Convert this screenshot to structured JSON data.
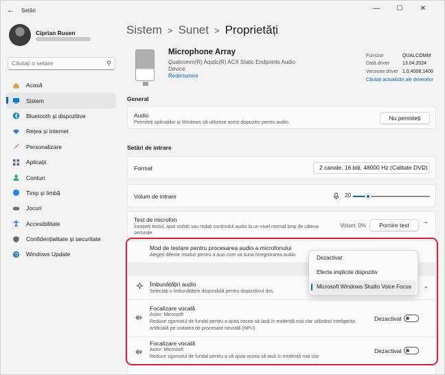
{
  "window": {
    "title": "Setări",
    "minimize_icon": "minimize-icon",
    "maximize_icon": "maximize-icon",
    "close_icon": "close-icon"
  },
  "user": {
    "name": "Ciprian Rusen"
  },
  "search": {
    "placeholder": "Căutați o setare"
  },
  "nav": [
    {
      "label": "Acasă",
      "icon": "home-icon",
      "color": "#d1a34a"
    },
    {
      "label": "Sistem",
      "icon": "system-icon",
      "color": "#0078d4"
    },
    {
      "label": "Bluetooth și dispozitive",
      "icon": "bluetooth-icon",
      "color": "#0078d4"
    },
    {
      "label": "Rețea și internet",
      "icon": "wifi-icon",
      "color": "#2b7cd3"
    },
    {
      "label": "Personalizare",
      "icon": "brush-icon",
      "color": "#e07a3a"
    },
    {
      "label": "Aplicații",
      "icon": "apps-icon",
      "color": "#5a6b86"
    },
    {
      "label": "Conturi",
      "icon": "account-icon",
      "color": "#2fa36b"
    },
    {
      "label": "Timp și limbă",
      "icon": "globe-icon",
      "color": "#1e88e5"
    },
    {
      "label": "Jocuri",
      "icon": "gamepad-icon",
      "color": "#707070"
    },
    {
      "label": "Accesibilitate",
      "icon": "accessibility-icon",
      "color": "#1a73c9"
    },
    {
      "label": "Confidențialitate și securitate",
      "icon": "shield-icon",
      "color": "#6b6b6b"
    },
    {
      "label": "Windows Update",
      "icon": "update-icon",
      "color": "#1a73c9"
    }
  ],
  "active_nav": "Sistem",
  "breadcrumb": [
    "Sistem",
    "Sunet",
    "Proprietăți"
  ],
  "device": {
    "name": "Microphone Array",
    "subtitle": "Qualcomm(R) Aqstic(R) ACX Static Endpoints Audio Device",
    "rename": "Redenumire",
    "info": [
      {
        "key": "Furnizor",
        "value": "QUALCOMM"
      },
      {
        "key": "Dată driver",
        "value": "13.04.2024"
      },
      {
        "key": "Versiune driver",
        "value": "1.0.4008.1400"
      }
    ],
    "driver_link": "Căutați actualizări ale driverelor"
  },
  "general": {
    "header": "General",
    "audio_title": "Audio",
    "audio_desc": "Permiteți aplicațiilor și Windows să utilizeze acest dispozitiv pentru audio",
    "audio_button": "Nu permiteți"
  },
  "input": {
    "header": "Setări de intrare",
    "format_label": "Format",
    "format_value": "2 canale, 16 biți, 48000 Hz (Calitate DVD)",
    "volume_label": "Volum de intrare",
    "volume_value": "20",
    "volume_level": 0.2
  },
  "mic_test": {
    "title": "Test de microfon",
    "desc": "Începeți testul, apoi vorbiți sau redați conținutul audio la un nivel normal timp de câteva secunde",
    "volume_text": "Volum: 0%",
    "button": "Pornire test"
  },
  "test_mode": {
    "title": "Mod de testare pentru procesarea audio a microfonului",
    "desc": "Alegeți diferite moduri pentru a auzi cum va suna înregistrarea audio"
  },
  "dropdown": {
    "options": [
      "Dezactivat",
      "Efecte implicite dispozitiv",
      "Microsoft Windows Studio Voice Focus"
    ],
    "selected": 2
  },
  "enhancements": {
    "title": "Îmbunătățiri audio",
    "desc": "Selectați o îmbunătățire disponibilă pentru dispozitivul dvs."
  },
  "voice_focus": [
    {
      "title": "Focalizare vocală",
      "author": "Autor: Microsoft",
      "desc1": "Reduce zgomotul de fundal pentru a ajuta vocea să iasă în evidență mai clar utilizând inteligența",
      "desc2": "artificială pe unitatea de procesare neurală (NPU)",
      "state": "Dezactivat"
    },
    {
      "title": "Focalizare vocală",
      "author": "Autor: Microsoft",
      "desc1": "Reduce zgomotul de fundal pentru a vă ajuta vocea să iasă în evidență mai clar",
      "desc2": "",
      "state": "Dezactivat"
    }
  ]
}
